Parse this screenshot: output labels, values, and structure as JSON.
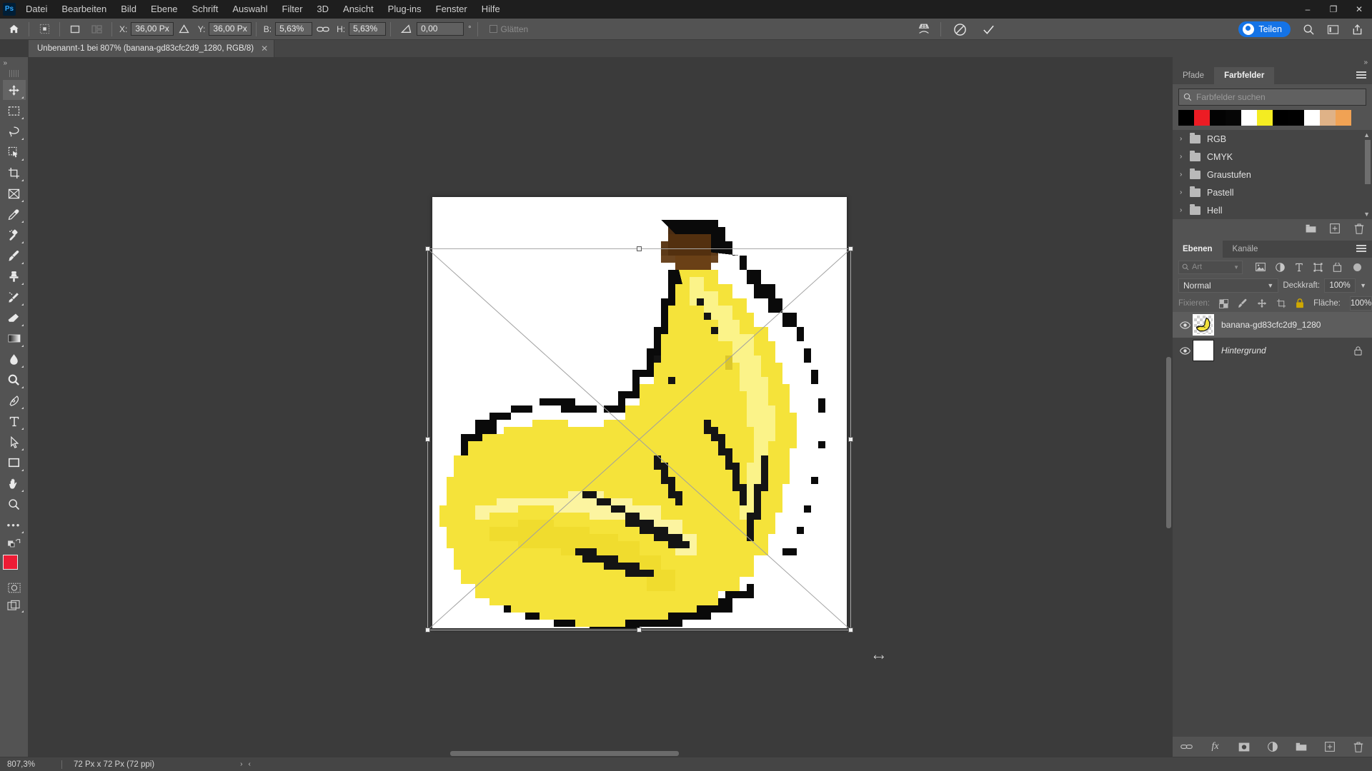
{
  "app": {
    "name": "Adobe Photoshop",
    "logo_text": "Ps"
  },
  "menubar": {
    "items": [
      {
        "label": "Datei"
      },
      {
        "label": "Bearbeiten"
      },
      {
        "label": "Bild"
      },
      {
        "label": "Ebene"
      },
      {
        "label": "Schrift"
      },
      {
        "label": "Auswahl"
      },
      {
        "label": "Filter"
      },
      {
        "label": "3D"
      },
      {
        "label": "Ansicht"
      },
      {
        "label": "Plug-ins"
      },
      {
        "label": "Fenster"
      },
      {
        "label": "Hilfe"
      }
    ],
    "window_controls": {
      "minimize": "–",
      "maximize": "❐",
      "close": "✕"
    }
  },
  "options_bar": {
    "home_icon": "home-icon",
    "reference_point_icon": "reference-point-icon",
    "fields": [
      {
        "label": "X:",
        "value": "36,00 Px"
      },
      {
        "label": "Y:",
        "value": "36,00 Px"
      },
      {
        "label": "B:",
        "value": "5,63%"
      },
      {
        "label": "H:",
        "value": "5,63%"
      },
      {
        "label": "",
        "value": "0,00"
      }
    ],
    "x_label": "X:",
    "x_value": "36,00 Px",
    "y_label": "Y:",
    "y_value": "36,00 Px",
    "w_label": "B:",
    "w_value": "5,63%",
    "h_label": "H:",
    "h_value": "5,63%",
    "angle_value": "0,00",
    "degree_symbol": "°",
    "link_icon": "link-icon",
    "smooth_label": "Glätten",
    "warp_icon": "warp-icon",
    "cancel_icon": "cancel-transform-icon",
    "commit_icon": "commit-transform-icon",
    "share_button": "Teilen",
    "search_icon": "search-icon",
    "workspace_icon": "workspace-icon",
    "export_icon": "export-icon"
  },
  "document_tab": {
    "title": "Unbenannt-1 bei 807% (banana-gd83cfc2d9_1280, RGB/8)",
    "close": "✕"
  },
  "toolbar": {
    "collapse": "»",
    "tools": [
      {
        "name": "move-tool",
        "label": "Verschieben-Werkzeug"
      },
      {
        "name": "rectangular-marquee-tool",
        "label": "Auswahlrechteck-Werkzeug"
      },
      {
        "name": "lasso-tool",
        "label": "Lasso-Werkzeug"
      },
      {
        "name": "quick-selection-tool",
        "label": "Schnellauswahl-Werkzeug"
      },
      {
        "name": "crop-tool",
        "label": "Freistellungswerkzeug"
      },
      {
        "name": "frame-tool",
        "label": "Rahmen-Werkzeug"
      },
      {
        "name": "eyedropper-tool",
        "label": "Pipette"
      },
      {
        "name": "spot-healing-brush-tool",
        "label": "Bereichsreparatur-Pinsel"
      },
      {
        "name": "brush-tool",
        "label": "Pinsel-Werkzeug"
      },
      {
        "name": "clone-stamp-tool",
        "label": "Kopierstempel"
      },
      {
        "name": "history-brush-tool",
        "label": "Protokollpinsel"
      },
      {
        "name": "eraser-tool",
        "label": "Radiergummi"
      },
      {
        "name": "gradient-tool",
        "label": "Verlaufswerkzeug"
      },
      {
        "name": "blur-tool",
        "label": "Weichzeichner"
      },
      {
        "name": "dodge-tool",
        "label": "Abwedler"
      },
      {
        "name": "pen-tool",
        "label": "Zeichenstift"
      },
      {
        "name": "type-tool",
        "label": "Textwerkzeug"
      },
      {
        "name": "path-selection-tool",
        "label": "Pfadauswahl-Werkzeug"
      },
      {
        "name": "rectangle-tool",
        "label": "Rechteck-Werkzeug"
      },
      {
        "name": "hand-tool",
        "label": "Hand-Werkzeug"
      },
      {
        "name": "zoom-tool",
        "label": "Zoom-Werkzeug"
      },
      {
        "name": "edit-toolbar-button",
        "label": "Werkzeugleiste bearbeiten"
      }
    ],
    "foreground_color": "#ed1c35",
    "background_color": "#0b0b0b",
    "quick_mask_icon": "quick-mask-icon",
    "screen_mode_icon": "screen-mode-icon"
  },
  "swatches_panel": {
    "tabs": [
      {
        "label": "Pfade",
        "active": false
      },
      {
        "label": "Farbfelder",
        "active": true
      }
    ],
    "search_placeholder": "Farbfelder suchen",
    "search_value": "",
    "swatch_colors": [
      "#000000",
      "#ed1c24",
      "#030303",
      "#060606",
      "#ffffff",
      "#f4ec22",
      "#000000",
      "#010101",
      "#ffffff",
      "#dfb287",
      "#f0a254"
    ],
    "groups": [
      {
        "label": "RGB"
      },
      {
        "label": "CMYK"
      },
      {
        "label": "Graustufen"
      },
      {
        "label": "Pastell"
      },
      {
        "label": "Hell"
      }
    ],
    "footer_icons": [
      "new-group-icon",
      "new-swatch-icon",
      "delete-swatch-icon"
    ]
  },
  "layers_panel": {
    "tabs": [
      {
        "label": "Ebenen",
        "active": true
      },
      {
        "label": "Kanäle",
        "active": false
      }
    ],
    "filter_placeholder": "Art",
    "filter_icons": [
      "image-filter-icon",
      "adjustment-filter-icon",
      "type-filter-icon",
      "shape-filter-icon",
      "smart-object-filter-icon"
    ],
    "blend_mode": "Normal",
    "opacity_label": "Deckkraft:",
    "opacity_value": "100%",
    "lock_label": "Fixieren:",
    "lock_icons": [
      "lock-transparent-pixels-icon",
      "lock-image-pixels-icon",
      "lock-position-icon",
      "lock-artboard-icon",
      "lock-all-icon"
    ],
    "fill_label": "Fläche:",
    "fill_value": "100%",
    "layers": [
      {
        "name": "banana-gd83cfc2d9_1280",
        "visible": true,
        "selected": true,
        "locked": false,
        "italic": false,
        "thumb": "banana"
      },
      {
        "name": "Hintergrund",
        "visible": true,
        "selected": false,
        "locked": true,
        "italic": true,
        "thumb": "white"
      }
    ],
    "footer_icons": [
      "link-layers-icon",
      "layer-style-icon",
      "layer-mask-icon",
      "adjustment-layer-icon",
      "new-group-icon",
      "new-layer-icon",
      "delete-layer-icon"
    ],
    "fx_label": "fx"
  },
  "status_bar": {
    "zoom": "807,3%",
    "dimensions": "72 Px x 72 Px (72 ppi)",
    "next_arrow": "›",
    "prev_arrow": "‹"
  },
  "canvas": {
    "document_background": "#ffffff",
    "workspace_background": "#3b3b3b",
    "artwork": "banana-pixel-art",
    "transform_active": true
  }
}
